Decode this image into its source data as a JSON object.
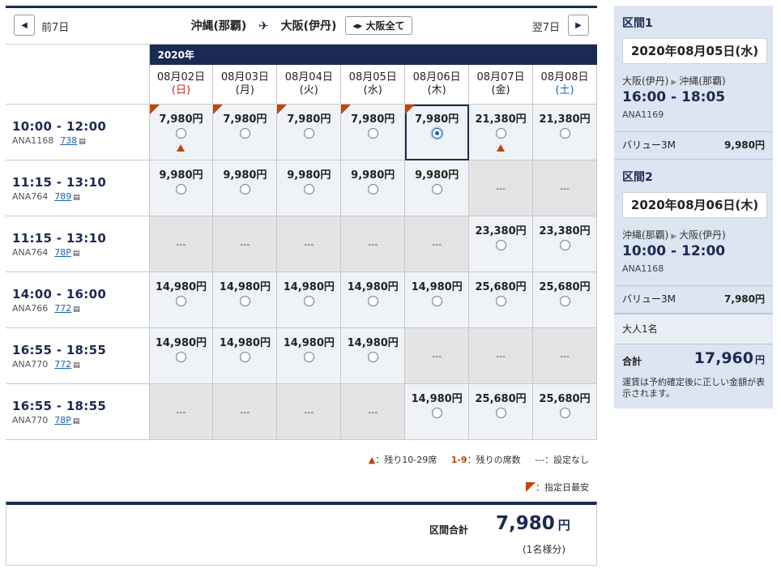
{
  "nav": {
    "prev_label": "前7日",
    "next_label": "翌7日",
    "origin": "沖縄(那覇)",
    "destination": "大阪(伊丹)",
    "all_label": "大阪全て"
  },
  "year": "2020年",
  "dates": [
    {
      "date": "08月02日",
      "dow": "(日)",
      "color": "red"
    },
    {
      "date": "08月03日",
      "dow": "(月)",
      "color": "normal"
    },
    {
      "date": "08月04日",
      "dow": "(火)",
      "color": "normal"
    },
    {
      "date": "08月05日",
      "dow": "(水)",
      "color": "normal"
    },
    {
      "date": "08月06日",
      "dow": "(木)",
      "color": "normal"
    },
    {
      "date": "08月07日",
      "dow": "(金)",
      "color": "normal"
    },
    {
      "date": "08月08日",
      "dow": "(土)",
      "color": "blue"
    }
  ],
  "flights": [
    {
      "time": "10:00 - 12:00",
      "flight": "ANA1168",
      "aircraft": "738",
      "cells": [
        {
          "price": "7,980円",
          "cheapest": true,
          "low": true
        },
        {
          "price": "7,980円",
          "cheapest": true
        },
        {
          "price": "7,980円",
          "cheapest": true
        },
        {
          "price": "7,980円",
          "cheapest": true
        },
        {
          "price": "7,980円",
          "cheapest": true,
          "selected": true
        },
        {
          "price": "21,380円",
          "low": true
        },
        {
          "price": "21,380円"
        }
      ]
    },
    {
      "time": "11:15 - 13:10",
      "flight": "ANA764",
      "aircraft": "789",
      "cells": [
        {
          "price": "9,980円"
        },
        {
          "price": "9,980円"
        },
        {
          "price": "9,980円"
        },
        {
          "price": "9,980円"
        },
        {
          "price": "9,980円"
        },
        {
          "na": "---"
        },
        {
          "na": "---"
        }
      ]
    },
    {
      "time": "11:15 - 13:10",
      "flight": "ANA764",
      "aircraft": "78P",
      "cells": [
        {
          "na": "---"
        },
        {
          "na": "---"
        },
        {
          "na": "---"
        },
        {
          "na": "---"
        },
        {
          "na": "---"
        },
        {
          "price": "23,380円"
        },
        {
          "price": "23,380円"
        }
      ]
    },
    {
      "time": "14:00 - 16:00",
      "flight": "ANA766",
      "aircraft": "772",
      "cells": [
        {
          "price": "14,980円"
        },
        {
          "price": "14,980円"
        },
        {
          "price": "14,980円"
        },
        {
          "price": "14,980円"
        },
        {
          "price": "14,980円"
        },
        {
          "price": "25,680円"
        },
        {
          "price": "25,680円"
        }
      ]
    },
    {
      "time": "16:55 - 18:55",
      "flight": "ANA770",
      "aircraft": "772",
      "cells": [
        {
          "price": "14,980円"
        },
        {
          "price": "14,980円"
        },
        {
          "price": "14,980円"
        },
        {
          "price": "14,980円"
        },
        {
          "na": "---"
        },
        {
          "na": "---"
        },
        {
          "na": "---"
        }
      ]
    },
    {
      "time": "16:55 - 18:55",
      "flight": "ANA770",
      "aircraft": "78P",
      "cells": [
        {
          "na": "---"
        },
        {
          "na": "---"
        },
        {
          "na": "---"
        },
        {
          "na": "---"
        },
        {
          "price": "14,980円"
        },
        {
          "price": "25,680円"
        },
        {
          "price": "25,680円"
        }
      ]
    }
  ],
  "legend": {
    "low_seats": "：残り10-29席",
    "few_code": "1-9",
    "few_label": "：残りの席数",
    "none": "---：設定なし",
    "cheapest": "：指定日最安"
  },
  "total": {
    "label": "区間合計",
    "amount": "7,980",
    "yen": "円",
    "note": "(1名様分)"
  },
  "summary": {
    "segments": [
      {
        "title": "区間1",
        "date": "2020年08月05日(水)",
        "from": "大阪(伊丹)",
        "to": "沖縄(那覇)",
        "time": "16:00 - 18:05",
        "flight": "ANA1169",
        "fare_name": "バリュー3M",
        "fare_price": "9,980円"
      },
      {
        "title": "区間2",
        "date": "2020年08月06日(木)",
        "from": "沖縄(那覇)",
        "to": "大阪(伊丹)",
        "time": "10:00 - 12:00",
        "flight": "ANA1168",
        "fare_name": "バリュー3M",
        "fare_price": "7,980円"
      }
    ],
    "pax": "大人1名",
    "sum_label": "合計",
    "sum_amount": "17,960",
    "sum_yen": "円",
    "note": "運賃は予約確定後に正しい金額が表示されます。"
  },
  "colors": {
    "navy": "#1b2a52",
    "accent": "#c1440e",
    "link": "#1e5fb3",
    "cell_bg": "#eff3f8",
    "na_bg": "#e4e4e4",
    "panel_bg": "#dce5f1"
  }
}
